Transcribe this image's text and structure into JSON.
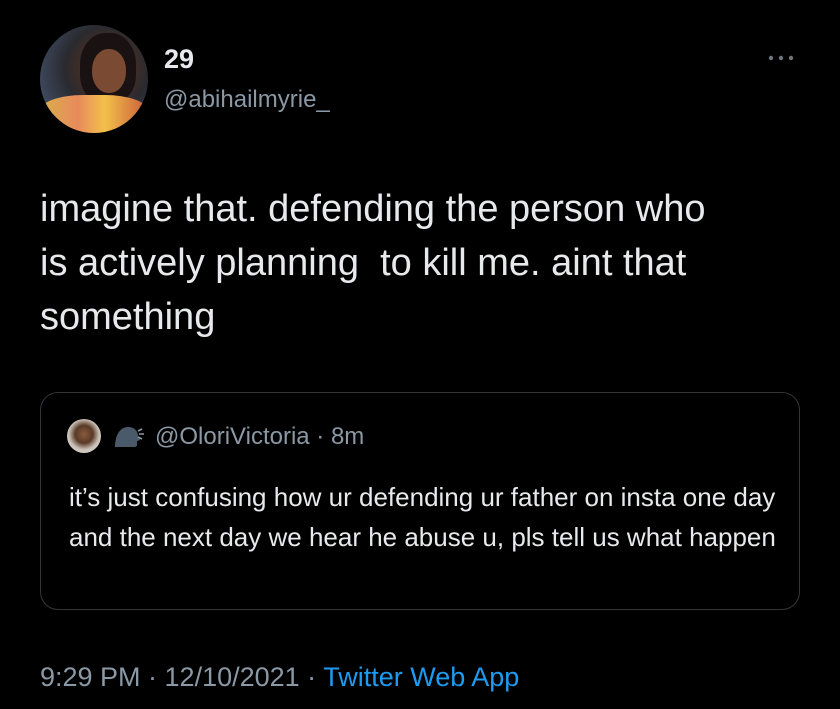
{
  "author": {
    "display_name": "29",
    "handle": "@abihailmyrie_"
  },
  "more_icon": "more-horizontal-icon",
  "tweet": {
    "text": "imagine that. defending the person who\nis actively planning  to kill me. aint that\nsomething"
  },
  "quoted_tweet": {
    "emoji_icon": "speaking-head-icon",
    "handle_line": "@OloriVictoria · 8m",
    "text": "it’s just confusing how ur defending ur father on insta one day and the next day we hear he abuse u, pls tell us what happen"
  },
  "meta": {
    "time_date": "9:29 PM · 12/10/2021 · ",
    "source": "Twitter Web App"
  },
  "colors": {
    "background": "#000000",
    "text": "#e7e9ea",
    "secondary": "#8b98a5",
    "link": "#1d9bf0",
    "border": "#333639"
  }
}
